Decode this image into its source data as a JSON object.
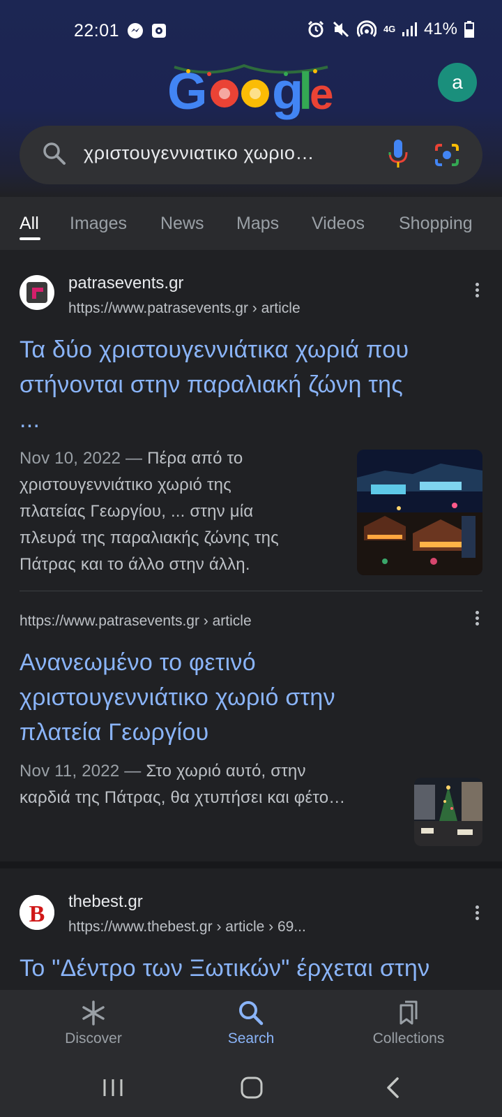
{
  "status": {
    "time": "22:01",
    "battery": "41%",
    "network": "4G"
  },
  "header": {
    "logo_text": "Google",
    "avatar_letter": "a"
  },
  "search": {
    "query": "χριστουγεννιατικο χωριο…"
  },
  "tabs": [
    {
      "label": "All",
      "active": true
    },
    {
      "label": "Images"
    },
    {
      "label": "News"
    },
    {
      "label": "Maps"
    },
    {
      "label": "Videos"
    },
    {
      "label": "Shopping"
    }
  ],
  "results": [
    {
      "site_name": "patrasevents.gr",
      "url": "https://www.patrasevents.gr",
      "path": " › article",
      "title_line1": "Τα δύο χριστουγεννιάτικα χωριά που",
      "title_line2": "στήνονται στην παραλιακή ζώνη της",
      "title_line3": "...",
      "date": "Nov 10, 2022 —",
      "snippet_line1": " Πέρα από το",
      "snippet_line2": "χριστουγεννιάτικο χωριό της",
      "snippet_line3": "πλατείας Γεωργίου, ... στην μία",
      "snippet_line4": "πλευρά της παραλιακής ζώνης της",
      "snippet_line5": "Πάτρας και το άλλο στην άλλη."
    },
    {
      "url": "https://www.patrasevents.gr",
      "path": " › article",
      "title_line1": "Ανανεωμένο το φετινό",
      "title_line2": "χριστουγεννιάτικο χωριό στην",
      "title_line3": "πλατεία Γεωργίου",
      "date": "Nov 11, 2022 —",
      "snippet_line1": " Στο χωριό αυτό, στην",
      "snippet_line2": "καρδιά της Πάτρας, θα χτυπήσει και φέτο…"
    },
    {
      "site_name": "thebest.gr",
      "url": "https://www.thebest.gr",
      "path": " › article › 69...",
      "title_line1": "Το \"Δέντρο των Ξωτικών\" έρχεται στην",
      "favicon_letter": "B"
    }
  ],
  "bottom_nav": [
    {
      "label": "Discover"
    },
    {
      "label": "Search",
      "active": true
    },
    {
      "label": "Collections"
    }
  ],
  "colors": {
    "link": "#8ab4f8",
    "background": "#202124",
    "header": "#1c2653"
  }
}
